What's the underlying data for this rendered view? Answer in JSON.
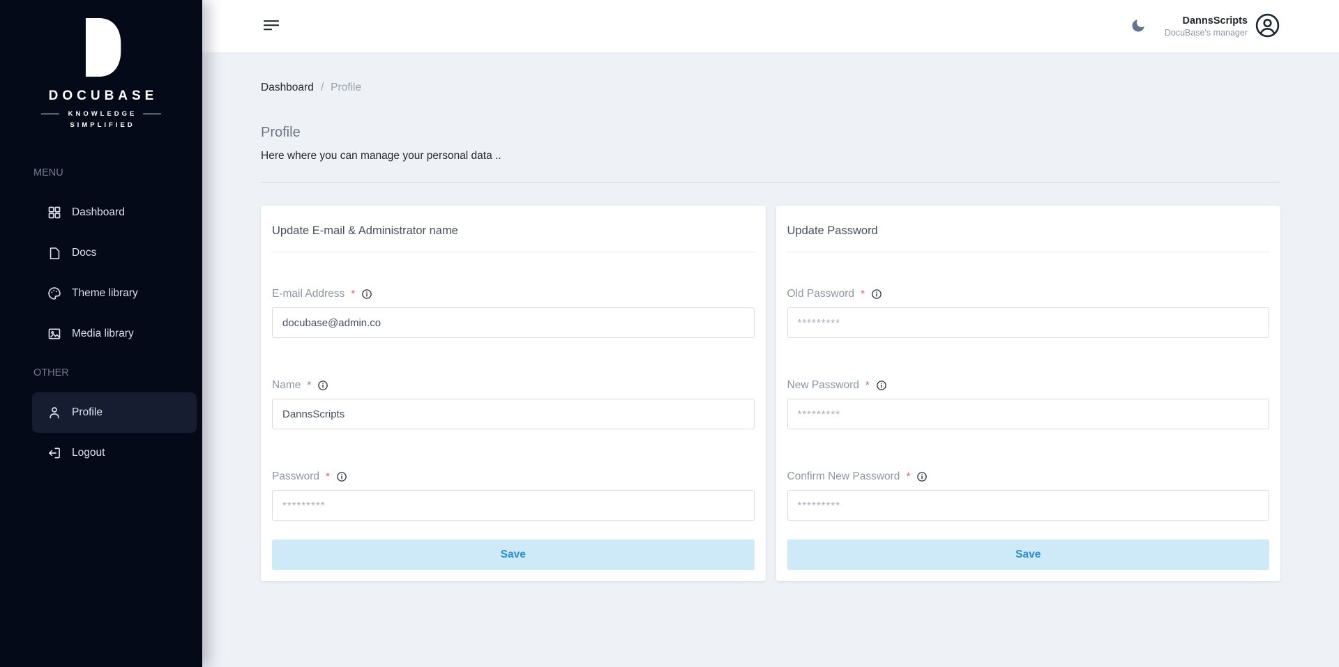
{
  "brand": {
    "name": "DOCUBASE",
    "tagline_top": "KNOWLEDGE",
    "tagline_bottom": "SIMPLIFIED"
  },
  "sidebar": {
    "sections": [
      {
        "label": "MENU",
        "items": [
          {
            "label": "Dashboard",
            "icon": "grid-icon",
            "active": false
          },
          {
            "label": "Docs",
            "icon": "document-icon",
            "active": false
          },
          {
            "label": "Theme library",
            "icon": "palette-icon",
            "active": false
          },
          {
            "label": "Media library",
            "icon": "image-icon",
            "active": false
          }
        ]
      },
      {
        "label": "OTHER",
        "items": [
          {
            "label": "Profile",
            "icon": "user-icon",
            "active": true
          },
          {
            "label": "Logout",
            "icon": "logout-icon",
            "active": false
          }
        ]
      }
    ]
  },
  "topbar": {
    "user_name": "DannsScripts",
    "user_role": "DocuBase's manager",
    "icons": [
      "hamburger-icon",
      "moon-icon",
      "user-circle-icon"
    ]
  },
  "breadcrumb": {
    "root": "Dashboard",
    "separator": "/",
    "current": "Profile"
  },
  "page": {
    "title": "Profile",
    "subtitle": "Here where you can manage your personal data .."
  },
  "cards": [
    {
      "title": "Update E-mail & Administrator name",
      "fields": [
        {
          "label": "E-mail Address",
          "required_mark": "*",
          "value": "docubase@admin.co",
          "placeholder": ""
        },
        {
          "label": "Name",
          "required_mark": "*",
          "value": "DannsScripts",
          "placeholder": ""
        },
        {
          "label": "Password",
          "required_mark": "*",
          "value": "",
          "placeholder": "*********"
        }
      ],
      "save_label": "Save"
    },
    {
      "title": "Update Password",
      "fields": [
        {
          "label": "Old Password",
          "required_mark": "*",
          "value": "",
          "placeholder": "*********"
        },
        {
          "label": "New Password",
          "required_mark": "*",
          "value": "",
          "placeholder": "*********"
        },
        {
          "label": "Confirm New Password",
          "required_mark": "*",
          "value": "",
          "placeholder": "*********"
        }
      ],
      "save_label": "Save"
    }
  ],
  "colors": {
    "sidebar_bg": "#050a18",
    "sidebar_active_bg": "#161d30",
    "main_bg": "#eef1f6",
    "card_bg": "#ffffff",
    "save_btn_bg": "#cee9f7",
    "save_btn_text": "#2a8fcb",
    "required_red": "#e4606d",
    "label_gray": "#8d95a3",
    "moon_gray": "#64748b"
  }
}
